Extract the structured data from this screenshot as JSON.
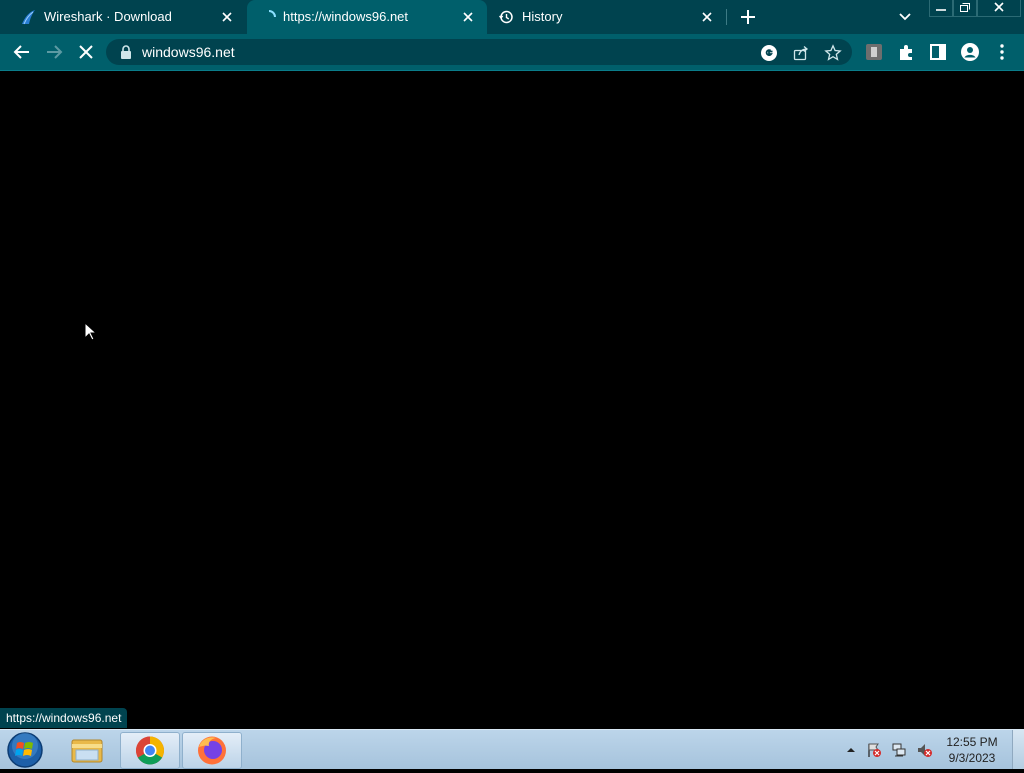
{
  "tabs": [
    {
      "title": "Wireshark · Download",
      "icon": "wireshark-fin-icon",
      "state": "inactive"
    },
    {
      "title": "https://windows96.net",
      "icon": "loading-spinner-icon",
      "state": "active"
    },
    {
      "title": "History",
      "icon": "history-icon",
      "state": "inactive"
    }
  ],
  "toolbar": {
    "url": "windows96.net"
  },
  "status_bubble": "https://windows96.net",
  "taskbar": {
    "time": "12:55 PM",
    "date": "9/3/2023",
    "apps": [
      "file-explorer-icon",
      "chrome-icon",
      "firefox-icon"
    ]
  },
  "colors": {
    "tab_strip": "#00434f",
    "active_tab": "#005f6b",
    "page_background": "#000000"
  }
}
